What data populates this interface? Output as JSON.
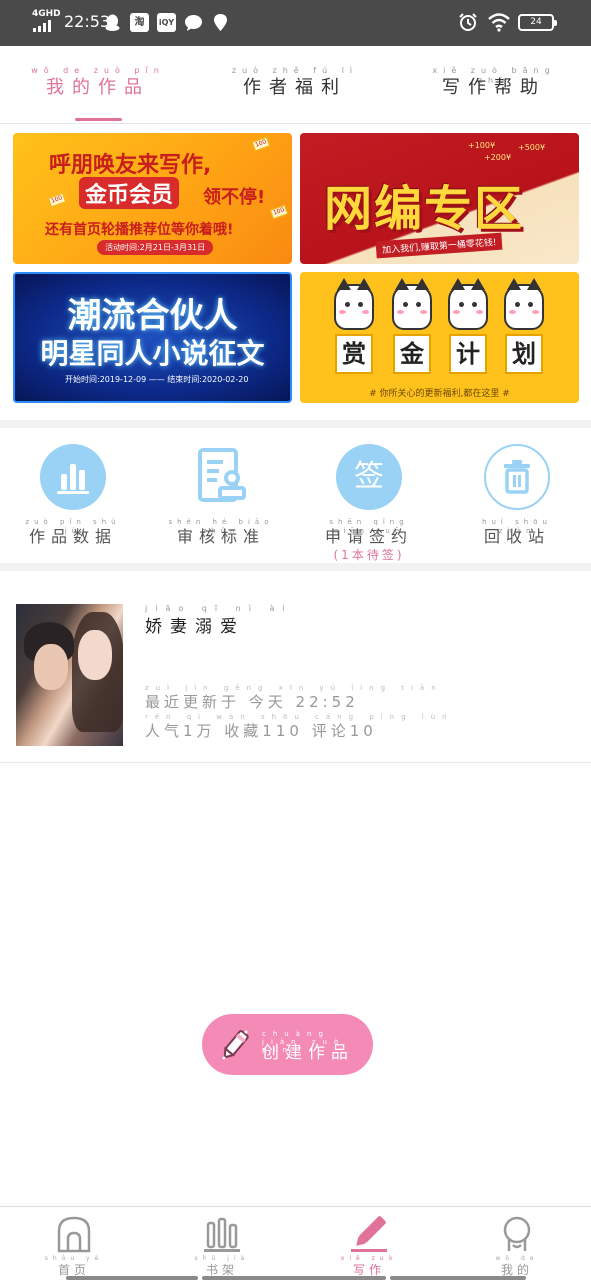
{
  "status_bar": {
    "network": "4GHD",
    "time": "22:53",
    "app_icons": [
      "qq-icon",
      "taobao-icon",
      "iqiyi-icon",
      "message-icon",
      "location-icon"
    ],
    "battery": "24"
  },
  "top_tabs": [
    {
      "pinyin": "wǒ de zuò pǐn",
      "label": "我的作品",
      "active": true
    },
    {
      "pinyin": "zuò zhě fú lì",
      "label": "作者福利",
      "active": false
    },
    {
      "pinyin": "xiě zuò bāng zhù",
      "label": "写作帮助",
      "active": false
    }
  ],
  "banners": {
    "recruit": {
      "line1": "呼朋唤友来写作,",
      "line2": "金币会员",
      "line2b": "领不停!",
      "line3": "还有首页轮播推荐位等你着哦!",
      "date": "活动时间:2月21日-3月31日",
      "coin": "100"
    },
    "web_editor": {
      "title": "网编专区",
      "money1": "+100¥",
      "money2": "+500¥",
      "money3": "+200¥",
      "tag": "加入我们,赚取第一桶零花钱!"
    },
    "partner": {
      "line1": "潮流合伙人",
      "line2": "明星同人小说征文",
      "dates": "开始时间:2019-12-09 —— 结束时间:2020-02-20"
    },
    "reward": {
      "chars": [
        "赏",
        "金",
        "计",
        "划"
      ],
      "footer": "# 你所关心的更新福利,都在这里 #"
    }
  },
  "tools": [
    {
      "pinyin": "zuò pǐn shù jù",
      "label": "作品数据",
      "icon": "bar-chart-icon"
    },
    {
      "pinyin": "shěn hé biāo zhǔn",
      "label": "审核标准",
      "icon": "document-stamp-icon"
    },
    {
      "pinyin": "shēn qǐng qiān yuē",
      "label": "申请签约",
      "icon": "sign-icon",
      "icon_text": "签",
      "note": "(1本待签)"
    },
    {
      "pinyin": "huí shōu zhàn",
      "label": "回收站",
      "icon": "trash-icon"
    }
  ],
  "works": [
    {
      "title_pinyin": "jiāo qī nì ài",
      "title": "娇妻溺爱",
      "update_pinyin": "zuì jìn gēng xīn yú líng tiān",
      "update": "最近更新于 今天 22:52",
      "stats_pinyin": "rén qì wàn shōu cáng píng lùn",
      "stats": "人气1万 收藏110 评论10"
    }
  ],
  "create_button": {
    "pinyin": "chuàng jiàn zuò pǐn",
    "label": "创建作品"
  },
  "bottom_nav": [
    {
      "pinyin": "shǒu yè",
      "label": "首页",
      "icon": "home-icon",
      "active": false
    },
    {
      "pinyin": "shū jià",
      "label": "书架",
      "icon": "bookshelf-icon",
      "active": false
    },
    {
      "pinyin": "xiě zuò",
      "label": "写作",
      "icon": "pen-icon",
      "active": true
    },
    {
      "pinyin": "wǒ de",
      "label": "我的",
      "icon": "profile-icon",
      "active": false
    }
  ],
  "colors": {
    "accent": "#e0729a",
    "create_button": "#f48ab6",
    "tool_icon": "#9ad2f5",
    "status_bar": "#4a4a4a"
  }
}
